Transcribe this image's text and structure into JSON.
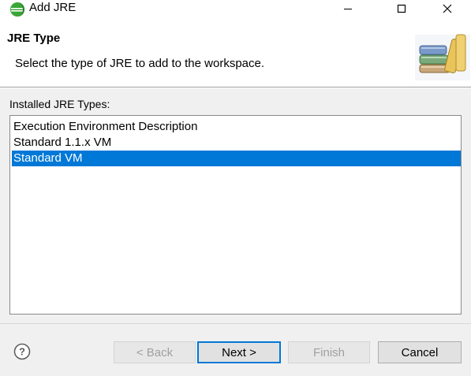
{
  "window": {
    "title": "Add JRE",
    "icons": {
      "app": "eclipse-icon",
      "minimize": "minimize-icon",
      "maximize": "maximize-icon",
      "close": "close-icon"
    }
  },
  "banner": {
    "title": "JRE Type",
    "description": "Select the type of JRE to add to the workspace.",
    "image": "library-books-icon"
  },
  "installed_types": {
    "label": "Installed JRE Types:",
    "items": [
      {
        "label": "Execution Environment Description",
        "selected": false
      },
      {
        "label": "Standard 1.1.x VM",
        "selected": false
      },
      {
        "label": "Standard VM",
        "selected": true
      }
    ]
  },
  "buttons": {
    "help_icon": "help-icon",
    "back": "< Back",
    "next": "Next >",
    "finish": "Finish",
    "cancel": "Cancel"
  },
  "colors": {
    "selection": "#0078d7",
    "default_button_border": "#0078d7",
    "eclipse_green": "#3aa635"
  }
}
